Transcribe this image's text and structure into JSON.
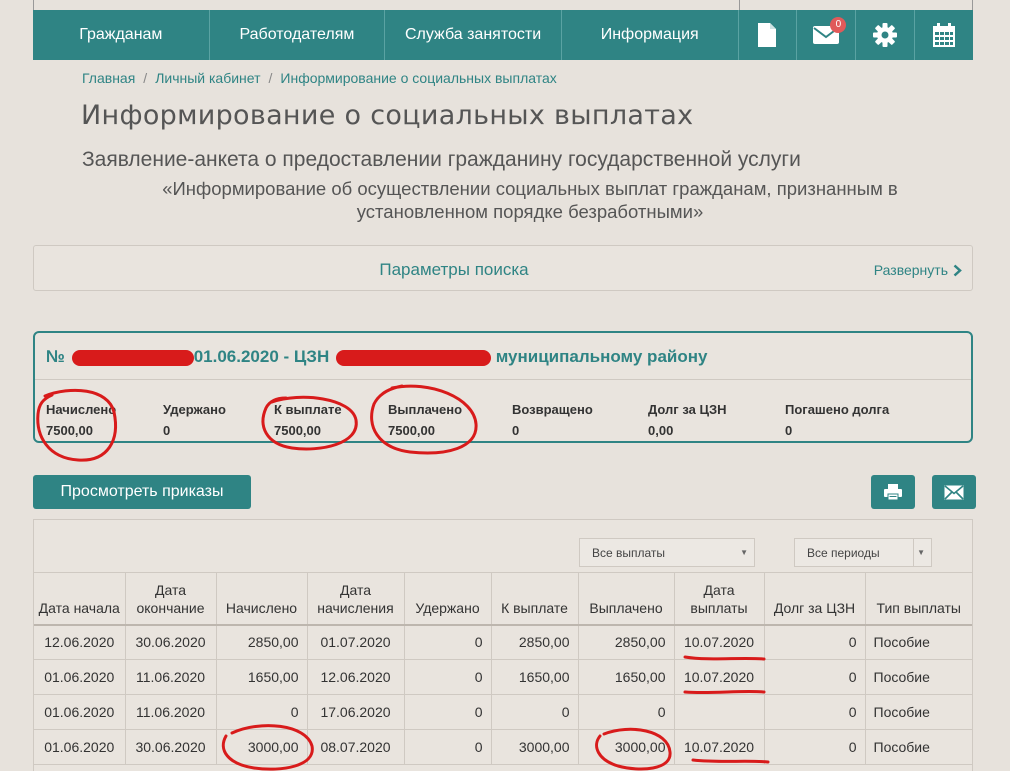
{
  "nav": {
    "items": [
      "Гражданам",
      "Работодателям",
      "Служба занятости",
      "Информация"
    ],
    "mail_badge": "0"
  },
  "breadcrumb": [
    "Главная",
    "Личный кабинет",
    "Информирование о социальных выплатах"
  ],
  "page_title": "Информирование о социальных выплатах",
  "subtitle": "Заявление-анкета о предоставлении гражданину государственной услуги",
  "subtitle2": "«Информирование об осуществлении социальных выплат гражданам, признанным в установленном порядке безработными»",
  "search": {
    "title": "Параметры поиска",
    "expand": "Развернуть"
  },
  "card": {
    "prefix": "№",
    "date_part": "01.06.2020 - ЦЗН",
    "suffix": "муниципальному району",
    "stats": [
      {
        "label": "Начислено",
        "value": "7500,00"
      },
      {
        "label": "Удержано",
        "value": "0"
      },
      {
        "label": "К выплате",
        "value": "7500,00"
      },
      {
        "label": "Выплачено",
        "value": "7500,00"
      },
      {
        "label": "Возвращено",
        "value": "0"
      },
      {
        "label": "Долг за ЦЗН",
        "value": "0,00"
      },
      {
        "label": "Погашено долга",
        "value": "0"
      }
    ]
  },
  "buttons": {
    "orders": "Просмотреть приказы"
  },
  "filters": {
    "payments": "Все выплаты",
    "periods": "Все периоды"
  },
  "table": {
    "headers": [
      "Дата начала",
      "Дата окончание",
      "Начислено",
      "Дата начисления",
      "Удержано",
      "К выплате",
      "Выплачено",
      "Дата выплаты",
      "Долг за ЦЗН",
      "Тип выплаты"
    ],
    "rows": [
      [
        "12.06.2020",
        "30.06.2020",
        "2850,00",
        "01.07.2020",
        "0",
        "2850,00",
        "2850,00",
        "10.07.2020",
        "0",
        "Пособие"
      ],
      [
        "01.06.2020",
        "11.06.2020",
        "1650,00",
        "12.06.2020",
        "0",
        "1650,00",
        "1650,00",
        "10.07.2020",
        "0",
        "Пособие"
      ],
      [
        "01.06.2020",
        "11.06.2020",
        "0",
        "17.06.2020",
        "0",
        "0",
        "0",
        "",
        "0",
        "Пособие"
      ],
      [
        "01.06.2020",
        "30.06.2020",
        "3000,00",
        "08.07.2020",
        "0",
        "3000,00",
        "3000,00",
        "10.07.2020",
        "0",
        "Пособие"
      ]
    ]
  },
  "colors": {
    "accent": "#2f8484",
    "background": "#e7e2dc",
    "annotation": "#d81b1b"
  }
}
